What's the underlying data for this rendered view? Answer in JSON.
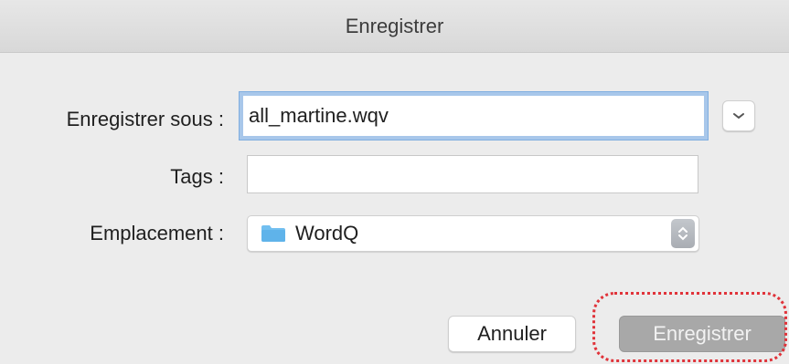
{
  "dialog": {
    "title": "Enregistrer",
    "fields": {
      "save_as_label": "Enregistrer sous :",
      "save_as_value": "all_martine.wqv",
      "tags_label": "Tags :",
      "tags_value": "",
      "location_label": "Emplacement :",
      "location_value": "WordQ"
    },
    "buttons": {
      "cancel_label": "Annuler",
      "save_label": "Enregistrer"
    }
  },
  "icons": {
    "expand": "chevron-down-icon",
    "folder": "folder-icon",
    "stepper": "up-down-stepper-icon"
  },
  "colors": {
    "folder_blue": "#72bff0",
    "focus_ring": "#a8c7ea",
    "highlight_red": "#e0333a",
    "disabled_button": "#a8a8a8"
  }
}
